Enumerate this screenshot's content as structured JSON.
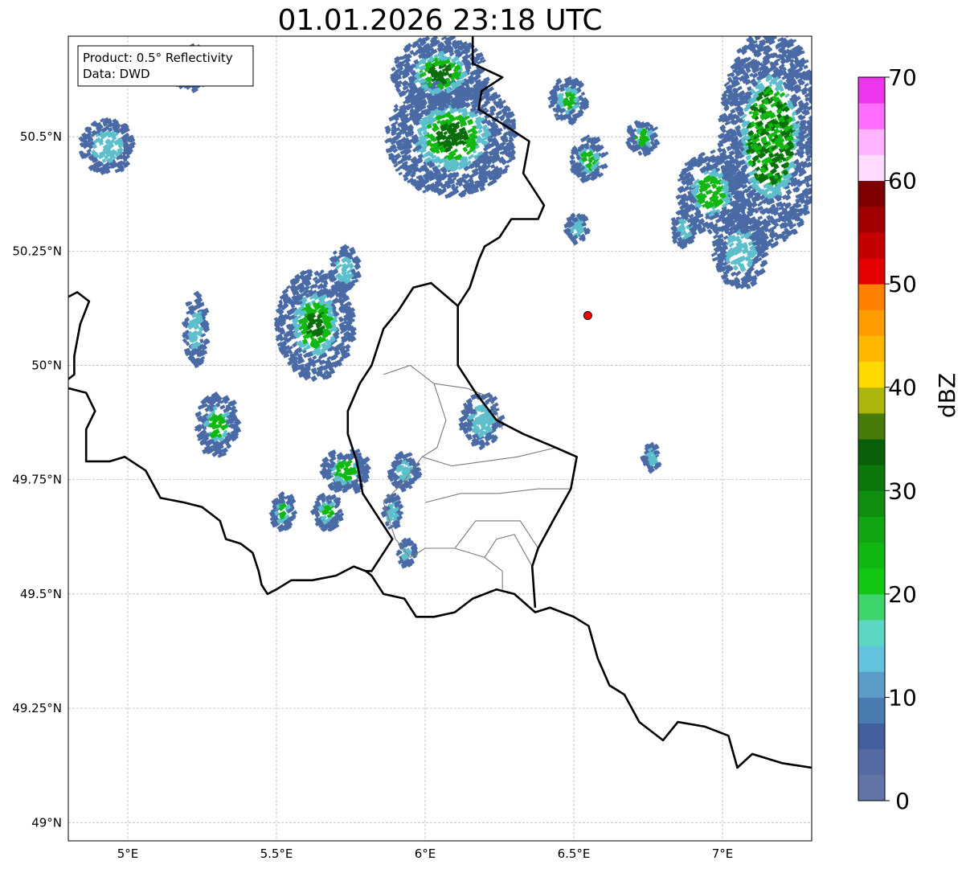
{
  "title": "01.01.2026 23:18 UTC",
  "info_box": {
    "line1": "Product: 0.5° Reflectivity",
    "line2": "Data: DWD"
  },
  "axes": {
    "lon_range": [
      4.8,
      7.3
    ],
    "lat_range": [
      48.96,
      50.72
    ],
    "lon_ticks": [
      {
        "value": 5.0,
        "label": "5°E"
      },
      {
        "value": 5.5,
        "label": "5.5°E"
      },
      {
        "value": 6.0,
        "label": "6°E"
      },
      {
        "value": 6.5,
        "label": "6.5°E"
      },
      {
        "value": 7.0,
        "label": "7°E"
      }
    ],
    "lat_ticks": [
      {
        "value": 50.5,
        "label": "50.5°N"
      },
      {
        "value": 50.25,
        "label": "50.25°N"
      },
      {
        "value": 50.0,
        "label": "50°N"
      },
      {
        "value": 49.75,
        "label": "49.75°N"
      },
      {
        "value": 49.5,
        "label": "49.5°N"
      },
      {
        "value": 49.25,
        "label": "49.25°N"
      },
      {
        "value": 49.0,
        "label": "49°N"
      }
    ],
    "grid": true
  },
  "radar_site": {
    "lon": 6.547,
    "lat": 50.109,
    "color": "#ff0000"
  },
  "colorbar": {
    "label": "dBZ",
    "min": 0,
    "max": 70,
    "step": 2.5,
    "tick_values": [
      "0",
      "10",
      "20",
      "30",
      "40",
      "50",
      "60",
      "70"
    ],
    "colors": [
      "#6374a7",
      "#556ba1",
      "#435f9f",
      "#4a7bb1",
      "#5b9dc6",
      "#63c2dc",
      "#5cd7c3",
      "#3dd46b",
      "#13c813",
      "#12b812",
      "#11a611",
      "#0f8e0f",
      "#0c780c",
      "#0a5f0a",
      "#477c0b",
      "#acb50b",
      "#ffd800",
      "#ffb700",
      "#ff9c00",
      "#ff7f00",
      "#e40000",
      "#c40000",
      "#a10000",
      "#7e0000",
      "#ffdcff",
      "#ffb4ff",
      "#ff6cff",
      "#ed35ed"
    ]
  },
  "echo_palette": {
    "light": "#4a6aa5",
    "mid": "#5dbfcc",
    "green": "#12b812",
    "dark": "#0a6e0a"
  },
  "echo_cells": [
    {
      "lon": 5.62,
      "lat": 50.09,
      "rlon": 0.13,
      "rlat": 0.12,
      "level": 3
    },
    {
      "lon": 5.22,
      "lat": 50.08,
      "rlon": 0.04,
      "rlat": 0.08,
      "level": 1
    },
    {
      "lon": 5.29,
      "lat": 49.87,
      "rlon": 0.07,
      "rlat": 0.07,
      "level": 2
    },
    {
      "lon": 4.92,
      "lat": 50.48,
      "rlon": 0.09,
      "rlat": 0.06,
      "level": 1
    },
    {
      "lon": 5.72,
      "lat": 50.21,
      "rlon": 0.05,
      "rlat": 0.05,
      "level": 1
    },
    {
      "lon": 5.72,
      "lat": 49.77,
      "rlon": 0.08,
      "rlat": 0.05,
      "level": 2
    },
    {
      "lon": 5.66,
      "lat": 49.68,
      "rlon": 0.05,
      "rlat": 0.04,
      "level": 2
    },
    {
      "lon": 5.51,
      "lat": 49.68,
      "rlon": 0.04,
      "rlat": 0.04,
      "level": 2
    },
    {
      "lon": 5.92,
      "lat": 49.77,
      "rlon": 0.05,
      "rlat": 0.04,
      "level": 1
    },
    {
      "lon": 6.18,
      "lat": 49.88,
      "rlon": 0.07,
      "rlat": 0.06,
      "level": 1
    },
    {
      "lon": 5.88,
      "lat": 49.68,
      "rlon": 0.03,
      "rlat": 0.04,
      "level": 1
    },
    {
      "lon": 5.93,
      "lat": 49.59,
      "rlon": 0.03,
      "rlat": 0.03,
      "level": 1
    },
    {
      "lon": 6.75,
      "lat": 49.8,
      "rlon": 0.03,
      "rlat": 0.03,
      "level": 1
    },
    {
      "lon": 6.08,
      "lat": 50.5,
      "rlon": 0.22,
      "rlat": 0.13,
      "level": 3
    },
    {
      "lon": 6.04,
      "lat": 50.64,
      "rlon": 0.16,
      "rlat": 0.08,
      "level": 3
    },
    {
      "lon": 6.54,
      "lat": 50.45,
      "rlon": 0.06,
      "rlat": 0.05,
      "level": 2
    },
    {
      "lon": 6.47,
      "lat": 50.58,
      "rlon": 0.06,
      "rlat": 0.05,
      "level": 2
    },
    {
      "lon": 6.72,
      "lat": 50.5,
      "rlon": 0.05,
      "rlat": 0.04,
      "level": 2
    },
    {
      "lon": 7.15,
      "lat": 50.5,
      "rlon": 0.17,
      "rlat": 0.24,
      "level": 4
    },
    {
      "lon": 6.95,
      "lat": 50.38,
      "rlon": 0.11,
      "rlat": 0.09,
      "level": 2
    },
    {
      "lon": 7.05,
      "lat": 50.25,
      "rlon": 0.09,
      "rlat": 0.08,
      "level": 1
    },
    {
      "lon": 5.2,
      "lat": 50.65,
      "rlon": 0.07,
      "rlat": 0.05,
      "level": 1
    },
    {
      "lon": 6.5,
      "lat": 50.3,
      "rlon": 0.04,
      "rlat": 0.03,
      "level": 1
    },
    {
      "lon": 6.86,
      "lat": 50.3,
      "rlon": 0.04,
      "rlat": 0.04,
      "level": 1
    }
  ],
  "borders": {
    "national": [
      [
        [
          4.8,
          50.15
        ],
        [
          4.83,
          50.16
        ],
        [
          4.87,
          50.14
        ],
        [
          4.84,
          50.09
        ],
        [
          4.82,
          50.02
        ],
        [
          4.82,
          49.98
        ],
        [
          4.8,
          49.97
        ]
      ],
      [
        [
          4.8,
          49.95
        ],
        [
          4.86,
          49.94
        ],
        [
          4.89,
          49.9
        ],
        [
          4.86,
          49.86
        ],
        [
          4.86,
          49.79
        ],
        [
          4.94,
          49.79
        ],
        [
          4.99,
          49.8
        ],
        [
          5.06,
          49.77
        ],
        [
          5.11,
          49.71
        ],
        [
          5.19,
          49.7
        ],
        [
          5.25,
          49.69
        ],
        [
          5.31,
          49.66
        ],
        [
          5.33,
          49.62
        ],
        [
          5.38,
          49.61
        ],
        [
          5.42,
          49.59
        ],
        [
          5.44,
          49.55
        ],
        [
          5.45,
          49.52
        ],
        [
          5.47,
          49.5
        ],
        [
          5.5,
          49.51
        ],
        [
          5.55,
          49.53
        ],
        [
          5.62,
          49.53
        ],
        [
          5.7,
          49.54
        ],
        [
          5.73,
          49.55
        ],
        [
          5.76,
          49.56
        ],
        [
          5.8,
          49.55
        ],
        [
          5.82,
          49.54
        ],
        [
          5.86,
          49.5
        ],
        [
          5.93,
          49.49
        ],
        [
          5.97,
          49.45
        ],
        [
          6.03,
          49.45
        ],
        [
          6.1,
          49.46
        ],
        [
          6.16,
          49.49
        ],
        [
          6.24,
          49.51
        ],
        [
          6.3,
          49.5
        ],
        [
          6.37,
          49.46
        ],
        [
          6.42,
          49.47
        ],
        [
          6.5,
          49.45
        ],
        [
          6.55,
          49.43
        ],
        [
          6.58,
          49.36
        ],
        [
          6.62,
          49.3
        ],
        [
          6.67,
          49.28
        ],
        [
          6.72,
          49.22
        ],
        [
          6.8,
          49.18
        ],
        [
          6.85,
          49.22
        ],
        [
          6.94,
          49.21
        ],
        [
          7.02,
          49.19
        ],
        [
          7.05,
          49.12
        ],
        [
          7.1,
          49.15
        ],
        [
          7.2,
          49.13
        ],
        [
          7.3,
          49.12
        ]
      ],
      [
        [
          6.37,
          49.47
        ],
        [
          6.36,
          49.56
        ],
        [
          6.38,
          49.6
        ],
        [
          6.43,
          49.66
        ],
        [
          6.49,
          49.73
        ],
        [
          6.51,
          49.8
        ],
        [
          6.44,
          49.82
        ],
        [
          6.33,
          49.85
        ],
        [
          6.24,
          49.88
        ],
        [
          6.17,
          49.94
        ],
        [
          6.11,
          50.0
        ],
        [
          6.11,
          50.06
        ],
        [
          6.11,
          50.13
        ],
        [
          6.15,
          50.17
        ],
        [
          6.18,
          50.23
        ],
        [
          6.2,
          50.26
        ],
        [
          6.25,
          50.28
        ],
        [
          6.29,
          50.32
        ],
        [
          6.38,
          50.32
        ],
        [
          6.4,
          50.35
        ],
        [
          6.33,
          50.42
        ],
        [
          6.35,
          50.49
        ],
        [
          6.28,
          50.52
        ],
        [
          6.18,
          50.56
        ],
        [
          6.19,
          50.6
        ],
        [
          6.26,
          50.63
        ],
        [
          6.16,
          50.66
        ],
        [
          6.16,
          50.72
        ]
      ],
      [
        [
          6.11,
          50.13
        ],
        [
          6.02,
          50.18
        ],
        [
          5.96,
          50.17
        ],
        [
          5.91,
          50.12
        ],
        [
          5.86,
          50.08
        ],
        [
          5.82,
          50.0
        ],
        [
          5.78,
          49.96
        ],
        [
          5.74,
          49.9
        ],
        [
          5.74,
          49.85
        ],
        [
          5.77,
          49.79
        ],
        [
          5.79,
          49.72
        ],
        [
          5.85,
          49.66
        ],
        [
          5.89,
          49.62
        ],
        [
          5.82,
          49.55
        ],
        [
          5.8,
          49.55
        ]
      ]
    ],
    "internal": [
      [
        [
          5.86,
          49.98
        ],
        [
          5.95,
          50.0
        ],
        [
          6.03,
          49.96
        ],
        [
          6.07,
          49.88
        ],
        [
          6.04,
          49.82
        ],
        [
          5.99,
          49.8
        ],
        [
          5.92,
          49.74
        ],
        [
          5.86,
          49.7
        ],
        [
          5.9,
          49.62
        ],
        [
          5.95,
          49.58
        ],
        [
          6.0,
          49.6
        ],
        [
          6.1,
          49.6
        ],
        [
          6.2,
          49.58
        ],
        [
          6.26,
          49.55
        ]
      ],
      [
        [
          6.03,
          49.96
        ],
        [
          6.14,
          49.95
        ],
        [
          6.22,
          49.93
        ],
        [
          6.26,
          49.86
        ]
      ],
      [
        [
          5.99,
          49.8
        ],
        [
          6.09,
          49.78
        ],
        [
          6.2,
          49.79
        ],
        [
          6.31,
          49.8
        ],
        [
          6.44,
          49.82
        ]
      ],
      [
        [
          6.0,
          49.7
        ],
        [
          6.12,
          49.72
        ],
        [
          6.25,
          49.72
        ],
        [
          6.38,
          49.73
        ],
        [
          6.49,
          49.73
        ]
      ],
      [
        [
          6.1,
          49.6
        ],
        [
          6.17,
          49.66
        ],
        [
          6.25,
          49.66
        ],
        [
          6.32,
          49.66
        ],
        [
          6.38,
          49.6
        ]
      ],
      [
        [
          6.2,
          49.58
        ],
        [
          6.24,
          49.62
        ],
        [
          6.3,
          49.63
        ],
        [
          6.36,
          49.56
        ]
      ],
      [
        [
          6.26,
          49.55
        ],
        [
          6.26,
          49.51
        ]
      ]
    ]
  }
}
